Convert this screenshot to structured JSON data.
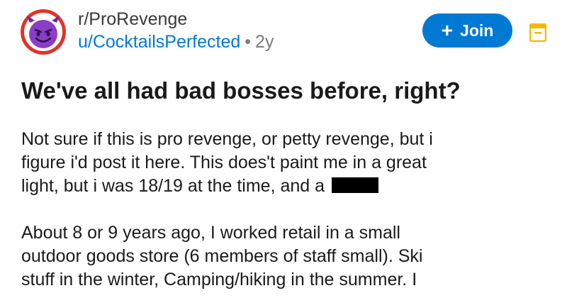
{
  "post": {
    "subreddit": "r/ProRevenge",
    "author": "u/CocktailsPerfected",
    "separator": "•",
    "age": "2y",
    "title": "We've all had bad bosses before, right?",
    "join_label": "Join",
    "join_icon": "plus-icon",
    "paragraphs": [
      [
        "Not sure if this is pro revenge, or petty revenge, but i",
        "figure i'd post it here. This does't paint me in a great",
        "light, but i was 18/19 at the time, and a"
      ],
      [
        "About 8 or 9 years ago, I worked retail in a small",
        "outdoor goods store (6 members of staff small). Ski",
        "stuff in the winter, Camping/hiking in the summer. I"
      ]
    ]
  },
  "colors": {
    "accent": "#0079d3",
    "save_icon": "#f5b800",
    "avatar_red": "#e0342a",
    "avatar_purple": "#8a3ec7"
  }
}
